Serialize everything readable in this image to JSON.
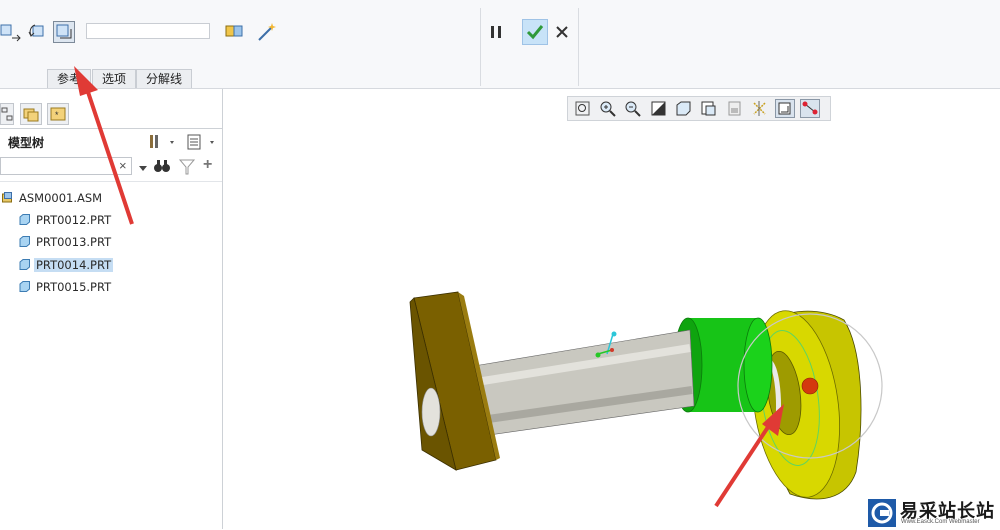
{
  "ribbon": {
    "tabs": [
      "参考",
      "选项",
      "分解线"
    ],
    "text_field_value": ""
  },
  "model_tree": {
    "title": "模型树",
    "search_value": "",
    "items": [
      {
        "label": "ASM0001.ASM",
        "type": "assembly",
        "selected": false
      },
      {
        "label": "PRT0012.PRT",
        "type": "part",
        "selected": false
      },
      {
        "label": "PRT0013.PRT",
        "type": "part",
        "selected": false
      },
      {
        "label": "PRT0014.PRT",
        "type": "part",
        "selected": true
      },
      {
        "label": "PRT0015.PRT",
        "type": "part",
        "selected": false
      }
    ]
  },
  "watermark": {
    "text": "易采站长站",
    "subtext": "Www.Easck.Com Webmaster"
  },
  "colors": {
    "accent_green": "#2f9a3a",
    "arrow_red": "#e03a35",
    "block_olive": "#7a6000",
    "shaft_gray": "#c9c8c0",
    "collar_green": "#17c417",
    "ring_yellow": "#d8d800",
    "selection_blue": "#c5ddf3"
  }
}
